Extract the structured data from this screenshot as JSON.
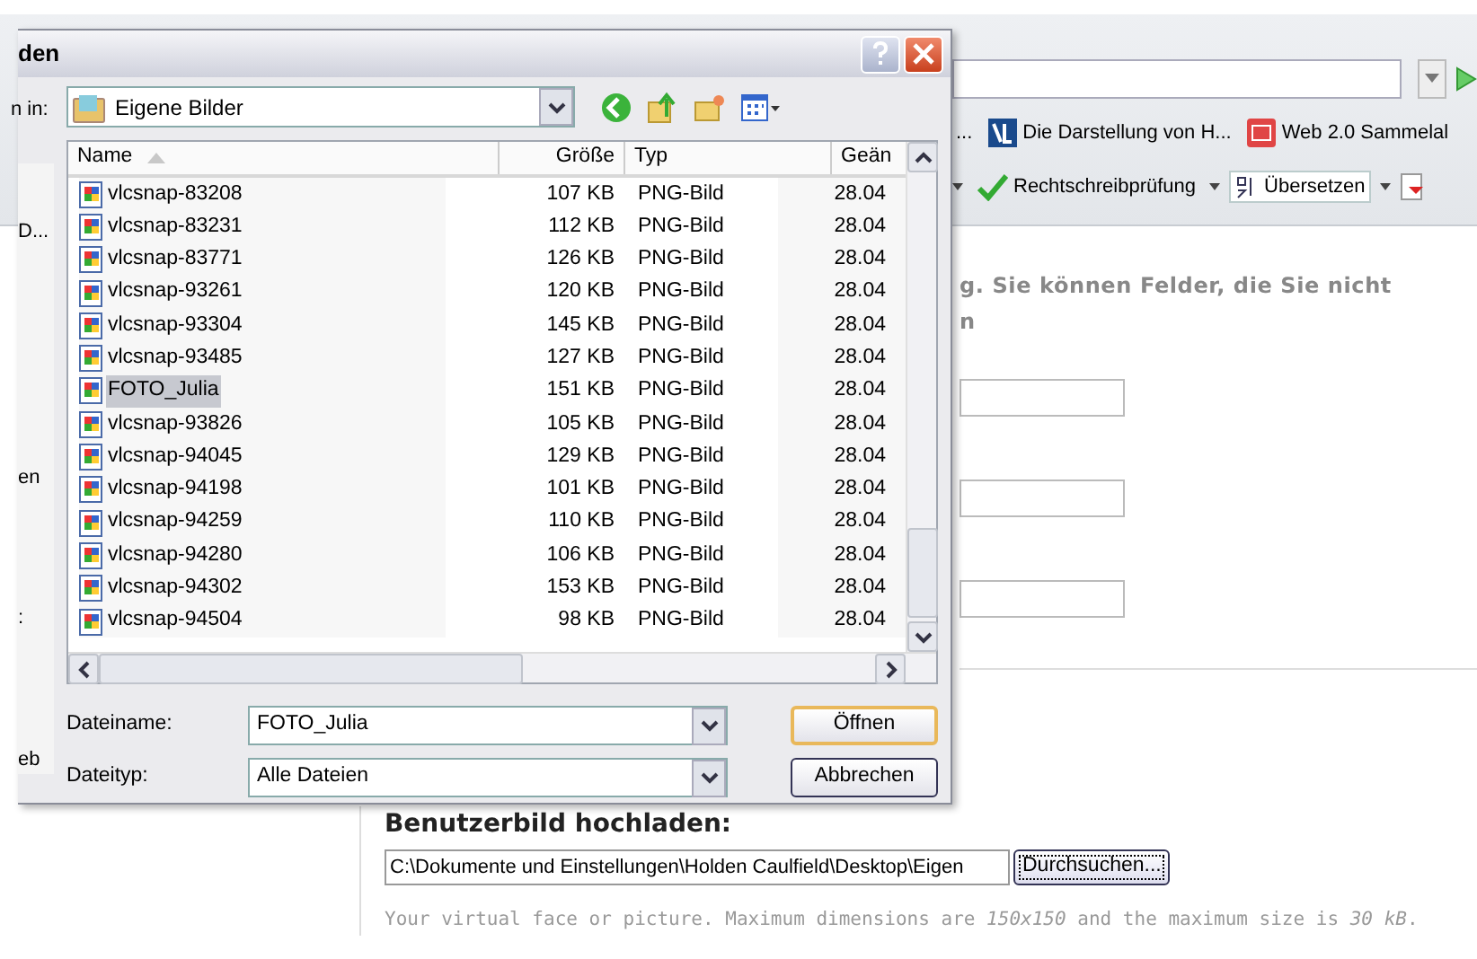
{
  "browser": {
    "bookmarks": [
      {
        "label": "..."
      },
      {
        "label": "Die Darstellung von H..."
      },
      {
        "label": "Web 2.0 Sammelal"
      }
    ],
    "toolbar": [
      {
        "label": "Rechtschreibprüfung"
      },
      {
        "label": "Übersetzen"
      }
    ],
    "page": {
      "intro": "g. Sie können Felder, die Sie nicht",
      "intro_2": "n",
      "upload_heading": "Benutzerbild hochladen:",
      "upload_path": "C:\\Dokumente und Einstellungen\\Holden Caulfield\\Desktop\\Eigen",
      "browse_button": "Durchsuchen...",
      "hint": "Your virtual face or picture. Maximum dimensions are *150x150* and the maximum size is *30 kB*."
    }
  },
  "dialog": {
    "title": "den",
    "look_in_label": "n in:",
    "look_in": "Eigene Bilder",
    "places": [
      {
        "label": "D..."
      },
      {
        "label": "en"
      },
      {
        "label": ":"
      },
      {
        "label": "eb"
      }
    ],
    "columns": [
      {
        "label": "Name",
        "sorted": true
      },
      {
        "label": "Größe",
        "sorted": false
      },
      {
        "label": "Typ",
        "sorted": false
      },
      {
        "label": "Geän",
        "sorted": false
      }
    ],
    "files": [
      {
        "name": "vlcsnap-83208",
        "size": "107 KB",
        "type": "PNG-Bild",
        "modified": "28.04",
        "selected": false
      },
      {
        "name": "vlcsnap-83231",
        "size": "112 KB",
        "type": "PNG-Bild",
        "modified": "28.04",
        "selected": false
      },
      {
        "name": "vlcsnap-83771",
        "size": "126 KB",
        "type": "PNG-Bild",
        "modified": "28.04",
        "selected": false
      },
      {
        "name": "vlcsnap-93261",
        "size": "120 KB",
        "type": "PNG-Bild",
        "modified": "28.04",
        "selected": false
      },
      {
        "name": "vlcsnap-93304",
        "size": "145 KB",
        "type": "PNG-Bild",
        "modified": "28.04",
        "selected": false
      },
      {
        "name": "vlcsnap-93485",
        "size": "127 KB",
        "type": "PNG-Bild",
        "modified": "28.04",
        "selected": false
      },
      {
        "name": "FOTO_Julia",
        "size": "151 KB",
        "type": "PNG-Bild",
        "modified": "28.04",
        "selected": true
      },
      {
        "name": "vlcsnap-93826",
        "size": "105 KB",
        "type": "PNG-Bild",
        "modified": "28.04",
        "selected": false
      },
      {
        "name": "vlcsnap-94045",
        "size": "129 KB",
        "type": "PNG-Bild",
        "modified": "28.04",
        "selected": false
      },
      {
        "name": "vlcsnap-94198",
        "size": "101 KB",
        "type": "PNG-Bild",
        "modified": "28.04",
        "selected": false
      },
      {
        "name": "vlcsnap-94259",
        "size": "110 KB",
        "type": "PNG-Bild",
        "modified": "28.04",
        "selected": false
      },
      {
        "name": "vlcsnap-94280",
        "size": "106 KB",
        "type": "PNG-Bild",
        "modified": "28.04",
        "selected": false
      },
      {
        "name": "vlcsnap-94302",
        "size": "153 KB",
        "type": "PNG-Bild",
        "modified": "28.04",
        "selected": false
      },
      {
        "name": "vlcsnap-94504",
        "size": "98 KB",
        "type": "PNG-Bild",
        "modified": "28.04",
        "selected": false
      }
    ],
    "filename_label": "Dateiname:",
    "filename": "FOTO_Julia",
    "filetype_label": "Dateityp:",
    "filetype": "Alle Dateien",
    "buttons": [
      {
        "label": "Öffnen",
        "default": true
      },
      {
        "label": "Abbrechen",
        "default": false
      }
    ]
  }
}
